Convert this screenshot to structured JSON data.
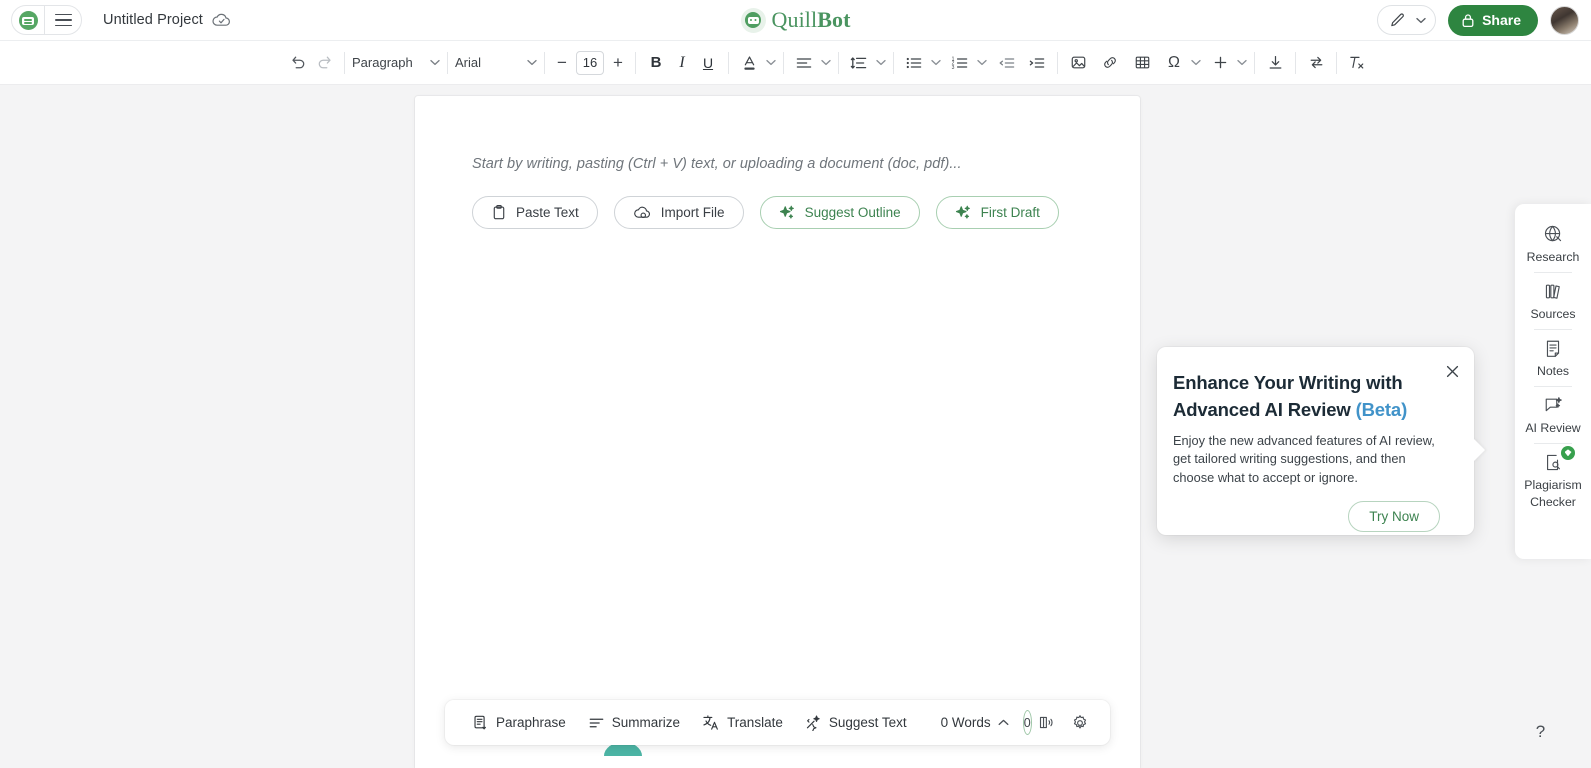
{
  "header": {
    "logo_icon": "quillbot-bot-icon",
    "menu_icon": "hamburger-menu-icon",
    "project_title": "Untitled Project",
    "cloud_icon": "cloud-saved-icon",
    "brand_quill": "Quill",
    "brand_bot": "Bot",
    "edit_mode_icon": "pencil-icon",
    "edit_mode_caret": "chevron-down-icon",
    "share_label": "Share",
    "share_icon": "lock-icon",
    "share_color": "#2e8540",
    "avatar": "user-avatar"
  },
  "toolbar": {
    "undo_icon": "undo-icon",
    "redo_icon": "redo-icon",
    "paragraph_style": "Paragraph",
    "font_family": "Arial",
    "font_size": "16",
    "decrease_label": "−",
    "increase_label": "+",
    "bold_label": "B",
    "italic_label": "I",
    "underline_label": "U",
    "text_color_icon": "text-color-icon",
    "align_icon": "align-left-icon",
    "line_spacing_icon": "line-spacing-icon",
    "bullet_list_icon": "bullet-list-icon",
    "numbered_list_icon": "numbered-list-icon",
    "outdent_icon": "outdent-icon",
    "indent_icon": "indent-icon",
    "image_icon": "insert-image-icon",
    "link_icon": "insert-link-icon",
    "table_icon": "insert-table-icon",
    "omega_label": "Ω",
    "plus_label": "+",
    "download_icon": "download-icon",
    "swap_icon": "compare-icon",
    "clear_format_icon": "clear-formatting-icon"
  },
  "editor": {
    "placeholder": "Start by writing, pasting (Ctrl + V) text, or uploading a document (doc, pdf)...",
    "actions": [
      {
        "label": "Paste Text",
        "icon": "clipboard-icon",
        "style": "plain"
      },
      {
        "label": "Import File",
        "icon": "cloud-upload-icon",
        "style": "plain"
      },
      {
        "label": "Suggest Outline",
        "icon": "sparkle-icon",
        "style": "green"
      },
      {
        "label": "First Draft",
        "icon": "sparkle-icon",
        "style": "green"
      }
    ]
  },
  "bottombar": {
    "items": [
      {
        "label": "Paraphrase",
        "icon": "paraphrase-icon"
      },
      {
        "label": "Summarize",
        "icon": "summarize-icon"
      },
      {
        "label": "Translate",
        "icon": "translate-icon"
      },
      {
        "label": "Suggest Text",
        "icon": "suggest-text-icon"
      }
    ],
    "word_count": "0 Words",
    "word_count_caret": "chevron-up-icon",
    "score": "0",
    "read_aloud_icon": "read-aloud-icon",
    "settings_icon": "gear-icon"
  },
  "rail": {
    "items": [
      {
        "label": "Research",
        "icon": "globe-research-icon",
        "badge": false
      },
      {
        "label": "Sources",
        "icon": "books-sources-icon",
        "badge": false
      },
      {
        "label": "Notes",
        "icon": "notes-icon",
        "badge": false
      },
      {
        "label": "AI Review",
        "icon": "ai-review-icon",
        "badge": false
      },
      {
        "label": "Plagiarism Checker",
        "icon": "plagiarism-icon",
        "badge": true
      }
    ]
  },
  "promo": {
    "title_main": "Enhance Your Writing with Advanced AI Review ",
    "title_beta": "(Beta)",
    "beta_color": "#4193c9",
    "body": "Enjoy the new advanced features of AI review, get tailored writing suggestions, and then choose what to accept or ignore.",
    "cta_label": "Try Now",
    "close_icon": "close-icon"
  },
  "help": {
    "label": "?",
    "icon": "help-icon"
  }
}
